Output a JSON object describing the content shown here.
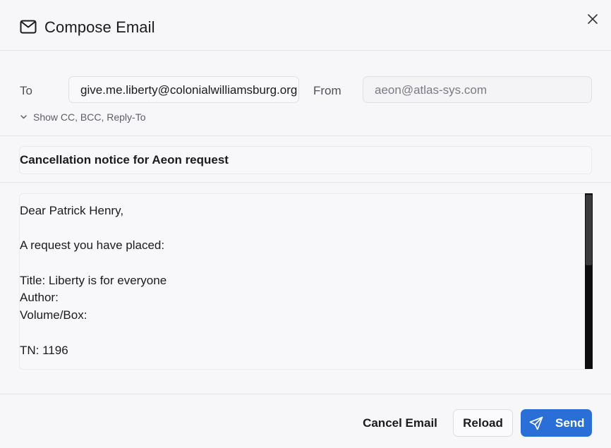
{
  "header": {
    "title": "Compose Email",
    "icons": {
      "title": "mail-icon",
      "close": "close-icon"
    }
  },
  "form": {
    "to_label": "To",
    "to_value": "give.me.liberty@colonialwilliamsburg.org",
    "from_label": "From",
    "from_value": "aeon@atlas-sys.com",
    "cc_toggle_label": "Show CC, BCC, Reply-To",
    "subject": "Cancellation notice for Aeon request"
  },
  "body": {
    "lines": [
      "Dear Patrick Henry,",
      "",
      "A request you have placed:",
      "",
      "Title: Liberty is for everyone",
      "Author:",
      "Volume/Box:",
      "",
      "TN: 1196"
    ]
  },
  "footer": {
    "cancel_label": "Cancel Email",
    "reload_label": "Reload",
    "send_label": "Send"
  },
  "colors": {
    "accent": "#2a6fd8",
    "background": "#f7f7f9",
    "scrollbar": "#0d0d0d"
  }
}
